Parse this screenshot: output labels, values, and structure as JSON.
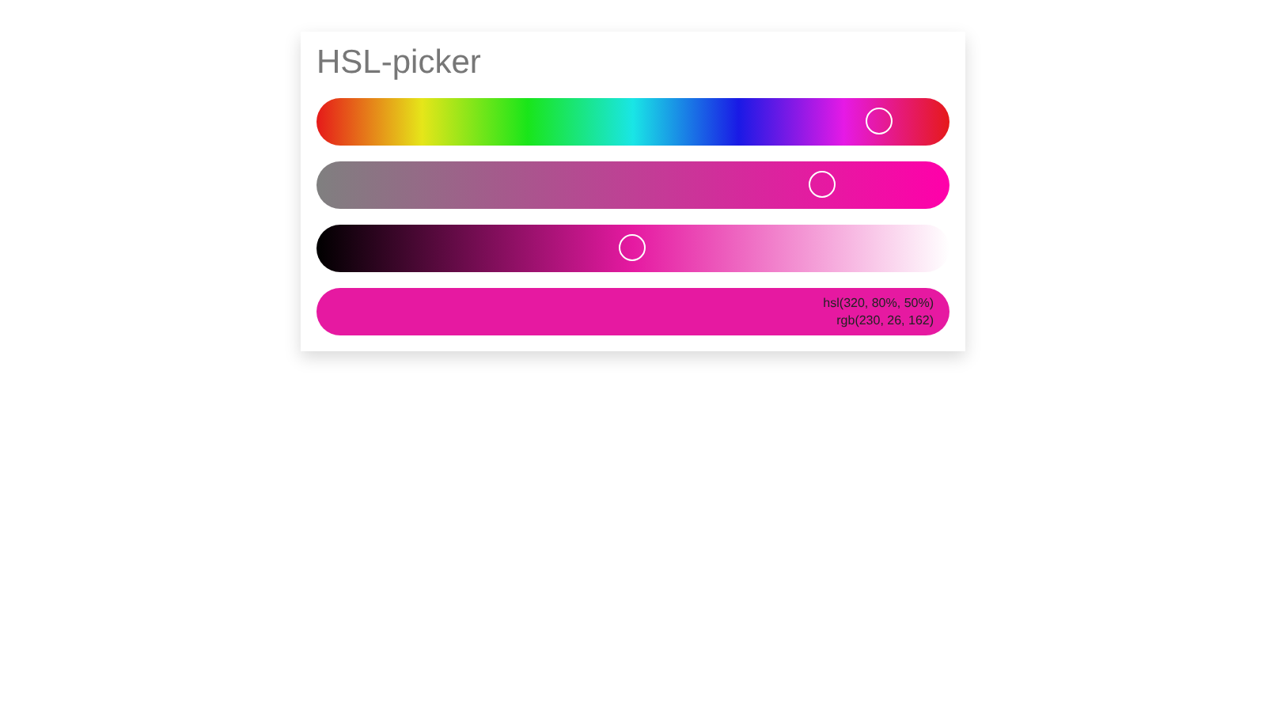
{
  "title": "HSL-picker",
  "sliders": [
    {
      "kind": "hue",
      "level": 0.8889
    },
    {
      "kind": "saturation",
      "level": 0.8
    },
    {
      "kind": "lightness",
      "level": 0.5
    }
  ],
  "preview": {
    "hsl": "hsl(320, 80%, 50%)",
    "rgb": "rgb(230, 26, 162)"
  }
}
